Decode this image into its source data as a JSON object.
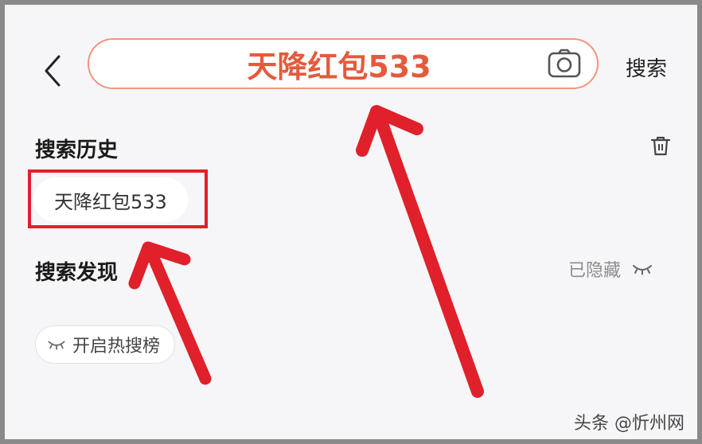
{
  "header": {
    "back_icon": "chevron-left-icon",
    "search_query": "天降红包533",
    "camera_icon": "camera-icon",
    "search_button_label": "搜索"
  },
  "history": {
    "title": "搜索历史",
    "clear_icon": "trash-icon",
    "items": [
      "天降红包533"
    ]
  },
  "discover": {
    "title": "搜索发现",
    "hidden_label": "已隐藏",
    "hidden_icon": "eye-closed-icon",
    "hot_search_label": "开启热搜榜",
    "hot_search_icon": "eye-closed-icon"
  },
  "watermark": "头条 @忻州网",
  "colors": {
    "accent": "#e55a3c",
    "search_border": "#f2957b",
    "annotation_red": "#e0202a"
  }
}
